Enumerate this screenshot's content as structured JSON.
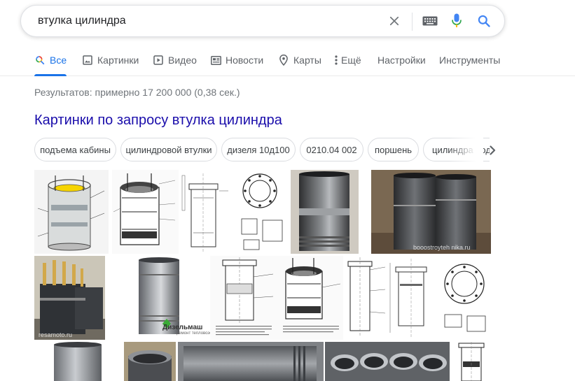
{
  "search": {
    "query": "втулка цилиндра",
    "icons": [
      "close-icon",
      "keyboard-icon",
      "microphone-icon",
      "search-icon"
    ]
  },
  "tabs": [
    {
      "label": "Все",
      "icon": "search-icon",
      "active": true
    },
    {
      "label": "Картинки",
      "icon": "image-icon"
    },
    {
      "label": "Видео",
      "icon": "play-icon"
    },
    {
      "label": "Новости",
      "icon": "news-icon"
    },
    {
      "label": "Карты",
      "icon": "map-pin-icon"
    },
    {
      "label": "Ещё",
      "icon": "more-vert-icon"
    },
    {
      "label": "Настройки"
    },
    {
      "label": "Инструменты"
    }
  ],
  "result_stats": "Результатов: примерно 17 200 000 (0,38 сек.)",
  "images_section": {
    "heading": "Картинки по запросу втулка цилиндра",
    "chips": [
      "подъема кабины",
      "цилиндровой втулки",
      "дизеля 10д100",
      "0210.04 002",
      "поршень",
      "цилиндра под"
    ],
    "watermarks": {
      "w1": "booostroyteh nika.ru",
      "w2": "resamoto.ru",
      "w3": "Дизельмаш",
      "w4": "ремонт тепловозов"
    }
  },
  "colors": {
    "accent": "#1a73e8",
    "link": "#1a0dab",
    "muted": "#70757a",
    "google_blue": "#4285f4",
    "google_red": "#ea4335",
    "google_yellow": "#fbbc05",
    "google_green": "#34a853"
  }
}
